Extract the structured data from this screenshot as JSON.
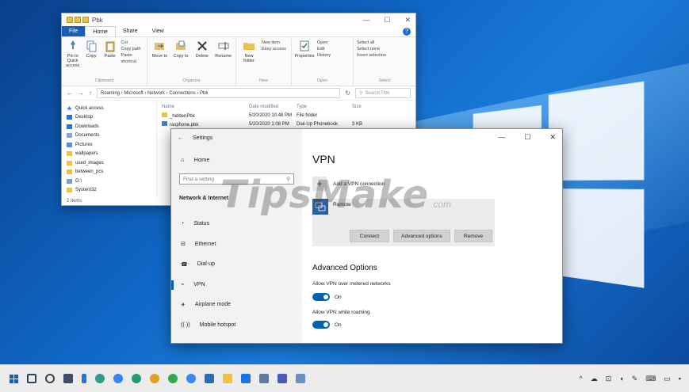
{
  "explorer": {
    "title": "Pbk",
    "tabs": [
      "File",
      "Home",
      "Share",
      "View"
    ],
    "ribbon": {
      "clipboard": {
        "pin": "Pin to Quick access",
        "copy": "Copy",
        "paste": "Paste",
        "cut": "Cut",
        "copy_path": "Copy path",
        "paste_shortcut": "Paste shortcut",
        "label": "Clipboard"
      },
      "organize": {
        "move_to": "Move to",
        "copy_to": "Copy to",
        "delete": "Delete",
        "rename": "Rename",
        "label": "Organize"
      },
      "new": {
        "new_folder": "New folder",
        "new_item": "New item",
        "easy_access": "Easy access",
        "label": "New"
      },
      "open": {
        "properties": "Properties",
        "open": "Open",
        "edit": "Edit",
        "history": "History",
        "label": "Open"
      },
      "select": {
        "select_all": "Select all",
        "select_none": "Select none",
        "invert": "Invert selection",
        "label": "Select"
      }
    },
    "address": {
      "path": "Roaming  ›  Microsoft  ›  Network  ›  Connections  ›  Pbk",
      "search_placeholder": "Search Pbk"
    },
    "nav_items": [
      "Quick access",
      "Desktop",
      "Downloads",
      "Documents",
      "Pictures",
      "wallpapers",
      "used_images",
      "between_pcs",
      "G:\\",
      "System32"
    ],
    "columns": [
      "Name",
      "Date modified",
      "Type",
      "Size"
    ],
    "files": [
      {
        "name": "_hiddenPbk",
        "date": "5/20/2020 10:48 PM",
        "type": "File folder",
        "size": ""
      },
      {
        "name": "rasphone.pbk",
        "date": "5/20/2020 1:08 PM",
        "type": "Dial-Up Phonebook",
        "size": "3 KB"
      }
    ],
    "status": "2 items"
  },
  "settings": {
    "window_title": "Settings",
    "home": "Home",
    "find_placeholder": "Find a setting",
    "group": "Network & Internet",
    "nav": [
      "Status",
      "Ethernet",
      "Dial-up",
      "VPN",
      "Airplane mode",
      "Mobile hotspot"
    ],
    "selected_nav": "VPN",
    "page_title": "VPN",
    "add_connection": "Add a VPN connection",
    "connection_name": "Remote",
    "buttons": {
      "connect": "Connect",
      "advanced": "Advanced options",
      "remove": "Remove"
    },
    "advanced_title": "Advanced Options",
    "options": [
      {
        "label": "Allow VPN over metered networks",
        "state": "On"
      },
      {
        "label": "Allow VPN while roaming",
        "state": "On"
      }
    ]
  },
  "watermark": {
    "main": "TipsMake",
    "suffix": ".com"
  },
  "colors": {
    "accent": "#0063b1",
    "desktop": "#0f66c4"
  }
}
